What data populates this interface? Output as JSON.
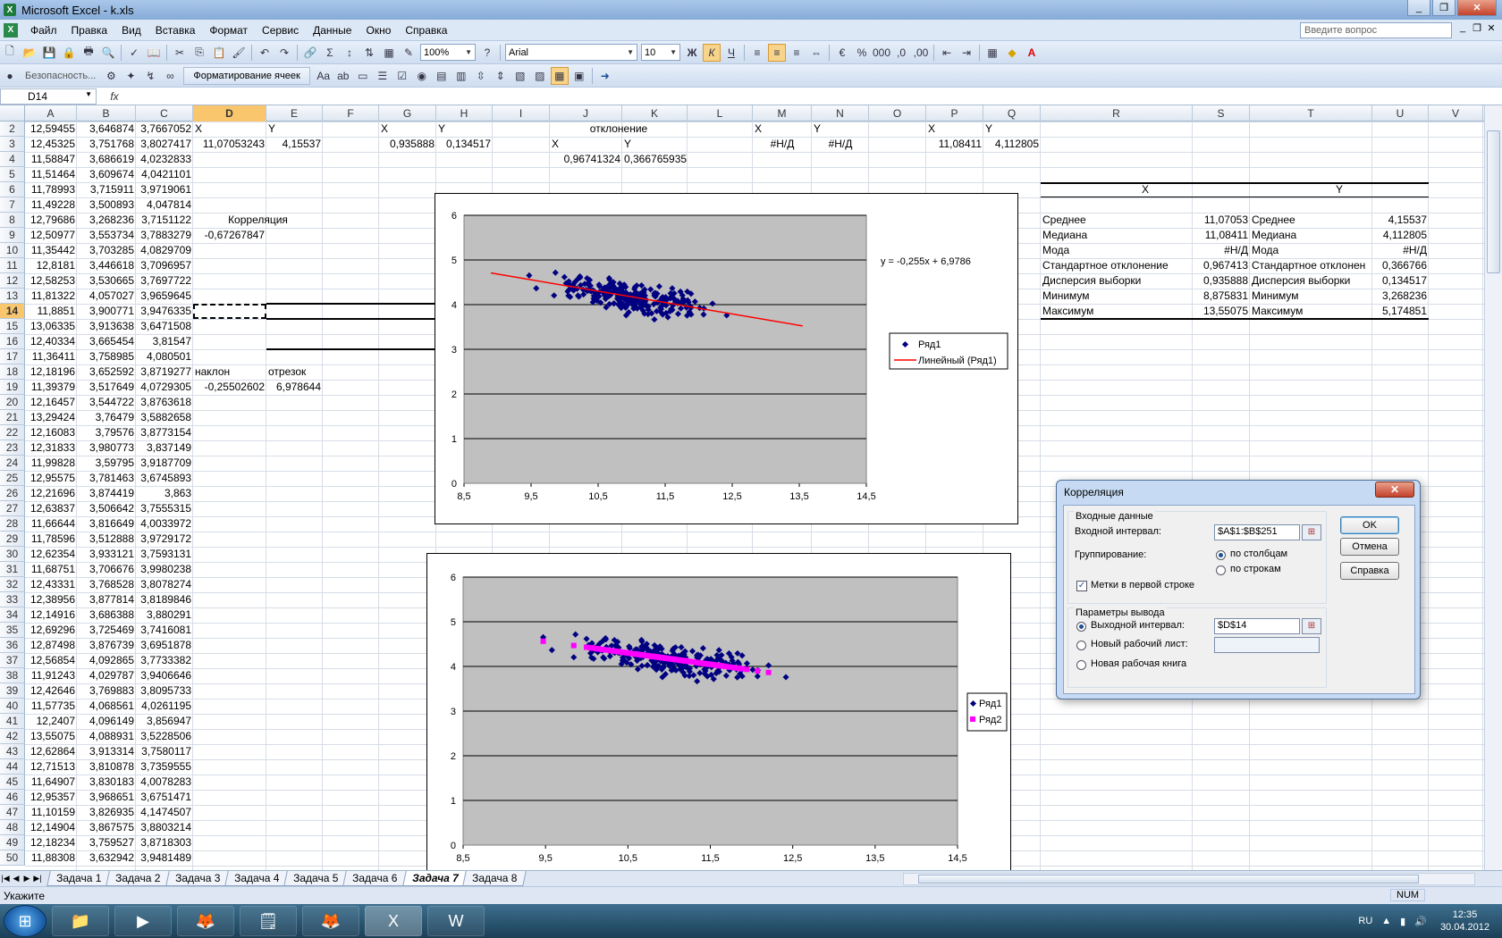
{
  "window": {
    "title": "Microsoft Excel - k.xls",
    "buttons": [
      "_",
      "❐",
      "✕"
    ]
  },
  "menu": {
    "items": [
      "Файл",
      "Правка",
      "Вид",
      "Вставка",
      "Формат",
      "Сервис",
      "Данные",
      "Окно",
      "Справка"
    ],
    "help_placeholder": "Введите вопрос"
  },
  "toolbar": {
    "zoom": "100%",
    "font": "Arial",
    "font_size": "10",
    "security_label": "Безопасность...",
    "format_cells_label": "Форматирование ячеек"
  },
  "formula_bar": {
    "name_box": "D14",
    "fx": "fx",
    "content": ""
  },
  "columns": [
    "A",
    "B",
    "C",
    "D",
    "E",
    "F",
    "G",
    "H",
    "I",
    "J",
    "K",
    "L",
    "M",
    "N",
    "O",
    "P",
    "Q",
    "R",
    "S",
    "T",
    "U",
    "V"
  ],
  "rows": [
    2,
    3,
    4,
    5,
    6,
    7,
    8,
    9,
    10,
    11,
    12,
    13,
    14,
    15,
    16,
    17,
    18,
    19,
    20,
    21,
    22,
    23,
    24,
    25,
    26,
    27,
    28,
    29,
    30,
    31,
    32,
    33,
    34,
    35,
    36,
    37,
    38,
    39,
    40,
    41,
    42,
    43,
    44,
    45,
    46,
    47,
    48,
    49,
    50
  ],
  "col_a": [
    "12,59455",
    "12,45325",
    "11,58847",
    "11,51464",
    "11,78993",
    "11,49228",
    "12,79686",
    "12,50977",
    "11,35442",
    "12,8181",
    "12,58253",
    "11,81322",
    "11,8851",
    "13,06335",
    "12,40334",
    "11,36411",
    "12,18196",
    "11,39379",
    "12,16457",
    "13,29424",
    "12,16083",
    "12,31833",
    "11,99828",
    "12,95575",
    "12,21696",
    "12,63837",
    "11,66644",
    "11,78596",
    "12,62354",
    "11,68751",
    "12,43331",
    "12,38956",
    "12,14916",
    "12,69296",
    "12,87498",
    "12,56854",
    "11,91243",
    "12,42646",
    "11,57735",
    "12,2407",
    "13,55075",
    "12,62864",
    "12,71513",
    "11,64907",
    "12,95357",
    "11,10159",
    "12,14904",
    "12,18234",
    "11,88308"
  ],
  "col_b": [
    "3,646874",
    "3,751768",
    "3,686619",
    "3,609674",
    "3,715911",
    "3,500893",
    "3,268236",
    "3,553734",
    "3,703285",
    "3,446618",
    "3,530665",
    "4,057027",
    "3,900771",
    "3,913638",
    "3,665454",
    "3,758985",
    "3,652592",
    "3,517649",
    "3,544722",
    "3,76479",
    "3,79576",
    "3,980773",
    "3,59795",
    "3,781463",
    "3,874419",
    "3,506642",
    "3,816649",
    "3,512888",
    "3,933121",
    "3,706676",
    "3,768528",
    "3,877814",
    "3,686388",
    "3,725469",
    "3,876739",
    "4,092865",
    "4,029787",
    "3,769883",
    "4,068561",
    "4,096149",
    "4,088931",
    "3,913314",
    "3,810878",
    "3,830183",
    "3,968651",
    "3,826935",
    "3,867575",
    "3,759527",
    "3,632942"
  ],
  "col_c": [
    "3,7667052",
    "3,8027417",
    "4,0232833",
    "4,0421101",
    "3,9719061",
    "4,047814",
    "3,7151122",
    "3,7883279",
    "4,0829709",
    "3,7096957",
    "3,7697722",
    "3,9659645",
    "3,9476335",
    "3,6471508",
    "3,81547",
    "4,080501",
    "3,8719277",
    "4,0729305",
    "3,8763618",
    "3,5882658",
    "3,8773154",
    "3,837149",
    "3,9187709",
    "3,6745893",
    "3,863",
    "3,7555315",
    "4,0033972",
    "3,9729172",
    "3,7593131",
    "3,9980238",
    "3,8078274",
    "3,8189846",
    "3,880291",
    "3,7416081",
    "3,6951878",
    "3,7733382",
    "3,9406646",
    "3,8095733",
    "4,0261195",
    "3,856947",
    "3,5228506",
    "3,7580117",
    "3,7359555",
    "4,0078283",
    "3,6751471",
    "4,1474507",
    "3,8803214",
    "3,8718303",
    "3,9481489"
  ],
  "cells": {
    "d2": "X",
    "e2": "Y",
    "g2": "X",
    "h2": "Y",
    "j2": "отклонение",
    "m2": "X",
    "n2": "Y",
    "p2": "X",
    "q2": "Y",
    "d3": "11,07053243",
    "e3": "4,15537",
    "g3": "0,935888",
    "h3": "0,134517",
    "j3": "X",
    "k3": "Y",
    "m3": "#Н/Д",
    "n3": "#Н/Д",
    "p3": "11,08411",
    "q3": "4,112805",
    "j4": "0,96741324",
    "k4": "0,366765935",
    "d8": "Корреляция",
    "d9": "-0,67267847",
    "d18": "наклон",
    "e18": "отрезок",
    "d19": "-0,25502602",
    "e19": "6,978644"
  },
  "stats": {
    "x_header": "X",
    "y_header": "Y",
    "rows": [
      {
        "lx": "Среднее",
        "vx": "11,07053",
        "ly": "Среднее",
        "vy": "4,15537"
      },
      {
        "lx": "Медиана",
        "vx": "11,08411",
        "ly": "Медиана",
        "vy": "4,112805"
      },
      {
        "lx": "Мода",
        "vx": "#Н/Д",
        "ly": "Мода",
        "vy": "#Н/Д"
      },
      {
        "lx": "Стандартное отклонение",
        "vx": "0,967413",
        "ly": "Стандартное отклонен",
        "vy": "0,366766"
      },
      {
        "lx": "Дисперсия выборки",
        "vx": "0,935888",
        "ly": "Дисперсия выборки",
        "vy": "0,134517"
      },
      {
        "lx": "Минимум",
        "vx": "8,875831",
        "ly": "Минимум",
        "vy": "3,268236"
      },
      {
        "lx": "Максимум",
        "vx": "13,55075",
        "ly": "Максимум",
        "vy": "5,174851"
      }
    ]
  },
  "chart_data": [
    {
      "type": "scatter",
      "xlim": [
        8.5,
        14.5
      ],
      "ylim": [
        0,
        6
      ],
      "x_ticks": [
        "8,5",
        "9,5",
        "10,5",
        "11,5",
        "12,5",
        "13,5",
        "14,5"
      ],
      "y_ticks": [
        "0",
        "1",
        "2",
        "3",
        "4",
        "5",
        "6"
      ],
      "grid": true,
      "legend": [
        "Ряд1",
        "Линейный (Ряд1)"
      ],
      "legend_position": "right",
      "trendline": {
        "slope": -0.255,
        "intercept": 6.9786,
        "x_range": [
          8.9,
          13.55
        ],
        "label": "y = -0,255x + 6,9786"
      },
      "series": [
        {
          "name": "Ряд1",
          "color": "#000080",
          "n_points": 250
        }
      ]
    },
    {
      "type": "scatter",
      "xlim": [
        8.5,
        14.5
      ],
      "ylim": [
        0,
        6
      ],
      "x_ticks": [
        "8,5",
        "9,5",
        "10,5",
        "11,5",
        "12,5",
        "13,5",
        "14,5"
      ],
      "y_ticks": [
        "0",
        "1",
        "2",
        "3",
        "4",
        "5",
        "6"
      ],
      "grid": true,
      "legend": [
        "Ряд1",
        "Ряд2"
      ],
      "legend_position": "right",
      "series": [
        {
          "name": "Ряд1",
          "color": "#000080",
          "n_points": 250
        },
        {
          "name": "Ряд2",
          "color": "#ff00ff",
          "slope": -0.255,
          "intercept": 6.9786
        }
      ]
    }
  ],
  "dialog": {
    "title": "Корреляция",
    "close": "✕",
    "input_group": "Входные данные",
    "input_range_label": "Входной интервал:",
    "input_range_value": "$A$1:$B$251",
    "grouping_label": "Группирование:",
    "by_columns": "по столбцам",
    "by_rows": "по строкам",
    "labels_first_row": "Метки в первой строке",
    "output_group": "Параметры вывода",
    "output_range_label": "Выходной интервал:",
    "output_range_value": "$D$14",
    "new_sheet": "Новый рабочий лист:",
    "new_book": "Новая рабочая книга",
    "ok": "OK",
    "cancel": "Отмена",
    "help": "Справка"
  },
  "sheets": [
    "Задача 1",
    "Задача 2",
    "Задача 3",
    "Задача 4",
    "Задача 5",
    "Задача 6",
    "Задача 7",
    "Задача 8"
  ],
  "active_sheet": "Задача 7",
  "status": {
    "left": "Укажите",
    "num": "NUM"
  },
  "tray": {
    "lang": "RU",
    "time": "12:35",
    "date": "30.04.2012"
  }
}
